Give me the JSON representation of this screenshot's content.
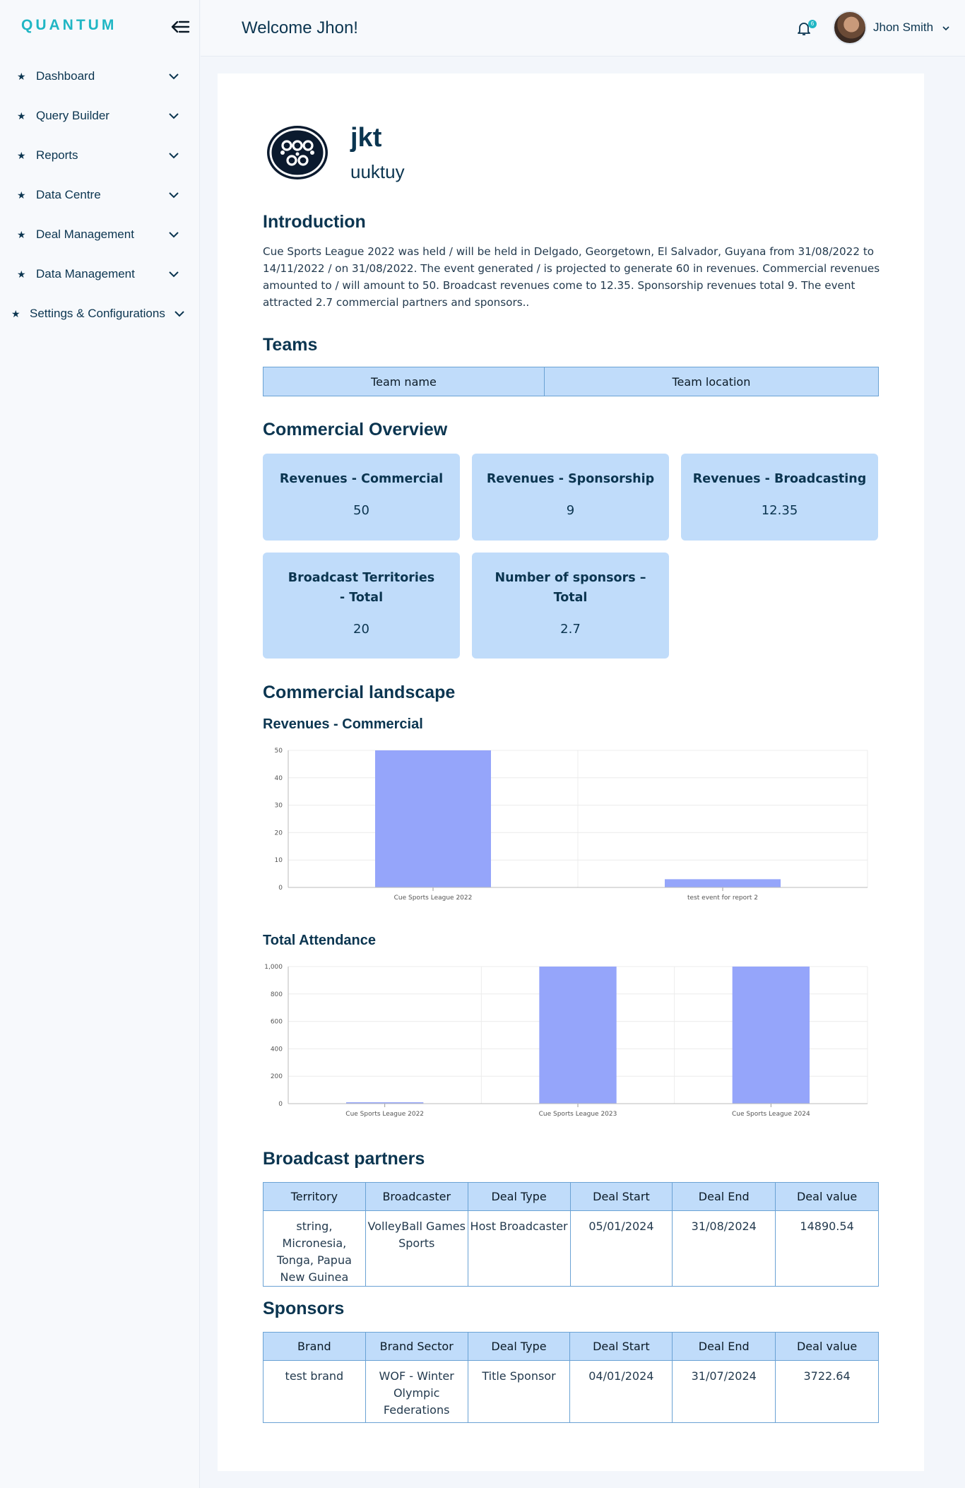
{
  "app": {
    "logo": "QUANTUM"
  },
  "sidebar": {
    "items": [
      {
        "label": "Dashboard"
      },
      {
        "label": "Query Builder"
      },
      {
        "label": "Reports"
      },
      {
        "label": "Data Centre"
      },
      {
        "label": "Deal Management"
      },
      {
        "label": "Data Management"
      },
      {
        "label": "Settings & Configurations"
      }
    ]
  },
  "header": {
    "welcome": "Welcome Jhon!",
    "notification_count": "6",
    "user_name": "Jhon Smith"
  },
  "event": {
    "title": "jkt",
    "subtitle": "uuktuy"
  },
  "intro": {
    "heading": "Introduction",
    "text": "Cue Sports League 2022 was held / will be held in Delgado, Georgetown, El Salvador, Guyana from 31/08/2022 to 14/11/2022 / on 31/08/2022. The event generated / is projected to generate 60 in revenues. Commercial revenues amounted to / will amount to 50. Broadcast revenues come to 12.35. Sponsorship revenues total 9. The event attracted 2.7 commercial partners and sponsors.."
  },
  "teams": {
    "heading": "Teams",
    "columns": [
      "Team name",
      "Team location"
    ]
  },
  "commercial_overview": {
    "heading": "Commercial Overview",
    "cards": [
      {
        "title": "Revenues - Commercial",
        "value": "50"
      },
      {
        "title": "Revenues - Sponsorship",
        "value": "9"
      },
      {
        "title": "Revenues - Broadcasting",
        "value": "12.35"
      },
      {
        "title": "Broadcast Territories - Total",
        "value": "20"
      },
      {
        "title": "Number of sponsors – Total",
        "value": "2.7"
      }
    ]
  },
  "commercial_landscape": {
    "heading": "Commercial landscape"
  },
  "chart_data": [
    {
      "type": "bar",
      "title": "Revenues - Commercial",
      "categories": [
        "Cue Sports League 2022",
        "test event for report 2"
      ],
      "values": [
        50,
        3
      ],
      "ylim": [
        0,
        50
      ],
      "yticks": [
        "0",
        "10",
        "20",
        "30",
        "40",
        "50"
      ],
      "grid": true,
      "color": "#95a5fa"
    },
    {
      "type": "bar",
      "title": "Total Attendance",
      "categories": [
        "Cue Sports League 2022",
        "Cue Sports League 2023",
        "Cue Sports League 2024"
      ],
      "values": [
        10,
        1000,
        1000
      ],
      "ylim": [
        0,
        1000
      ],
      "yticks": [
        "0",
        "200",
        "400",
        "600",
        "800",
        "1,000"
      ],
      "grid": true,
      "color": "#95a5fa"
    }
  ],
  "broadcast_partners": {
    "heading": "Broadcast partners",
    "columns": [
      "Territory",
      "Broadcaster",
      "Deal Type",
      "Deal Start",
      "Deal End",
      "Deal value"
    ],
    "rows": [
      [
        "string, Micronesia, Tonga, Papua New Guinea",
        "VolleyBall Games Sports",
        "Host Broadcaster",
        "05/01/2024",
        "31/08/2024",
        "14890.54"
      ]
    ]
  },
  "sponsors": {
    "heading": "Sponsors",
    "columns": [
      "Brand",
      "Brand Sector",
      "Deal Type",
      "Deal Start",
      "Deal End",
      "Deal value"
    ],
    "rows": [
      [
        "test brand",
        "WOF - Winter Olympic Federations",
        "Title Sponsor",
        "04/01/2024",
        "31/07/2024",
        "3722.64"
      ]
    ]
  }
}
